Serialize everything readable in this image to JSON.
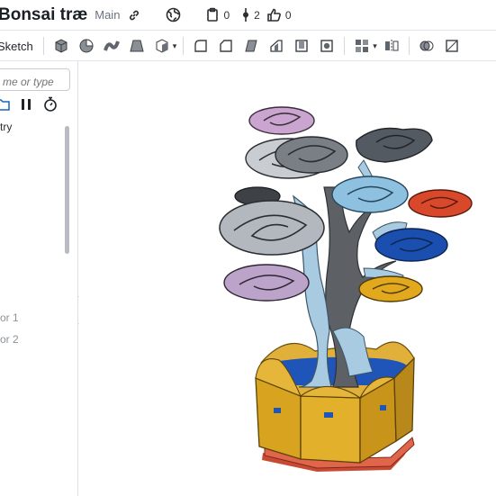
{
  "titlebar": {
    "document_name": "Bonsai træ",
    "branch": "Main",
    "copies_count": "0",
    "versions_count": "2",
    "likes_count": "0"
  },
  "toolbar": {
    "sketch_label": "Sketch"
  },
  "feature_panel": {
    "filter_placeholder": "me or type",
    "tree_items": [
      "try",
      "or 1",
      "or 2"
    ]
  },
  "colors": {
    "accent": "#1565c0",
    "pot_yellow": "#d8a31e",
    "base_red": "#d9573a",
    "trunk_gray": "#5d6166",
    "trunk_blue": "#a9cbe2"
  }
}
